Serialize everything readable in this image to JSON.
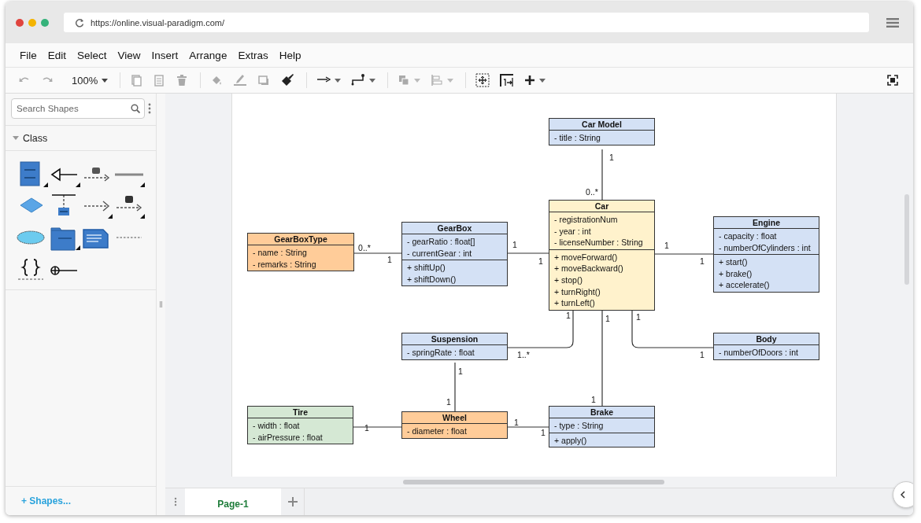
{
  "browser": {
    "url": "https://online.visual-paradigm.com/"
  },
  "menu": [
    "File",
    "Edit",
    "Select",
    "View",
    "Insert",
    "Arrange",
    "Extras",
    "Help"
  ],
  "toolbar": [
    [
      {
        "kind": "undo",
        "disabled": true
      },
      {
        "kind": "redo",
        "disabled": true
      },
      {
        "kind": "zoom",
        "label": "100%",
        "disabled": false
      }
    ],
    [
      {
        "kind": "copy",
        "disabled": true
      },
      {
        "kind": "paste",
        "disabled": true
      },
      {
        "kind": "delete",
        "disabled": true
      }
    ],
    [
      {
        "kind": "fill",
        "disabled": true
      },
      {
        "kind": "line-color",
        "disabled": true
      },
      {
        "kind": "shadow",
        "disabled": true
      },
      {
        "kind": "format",
        "disabled": false
      }
    ],
    [
      {
        "kind": "connector",
        "disabled": false
      },
      {
        "kind": "waypoint",
        "disabled": false
      }
    ],
    [
      {
        "kind": "to-front",
        "disabled": true
      },
      {
        "kind": "align",
        "disabled": true
      }
    ],
    [
      {
        "kind": "fit",
        "disabled": false
      },
      {
        "kind": "page-size",
        "disabled": false
      },
      {
        "kind": "insert",
        "disabled": false
      }
    ]
  ],
  "toolbar_right": [
    {
      "kind": "fullscreen",
      "disabled": false
    }
  ],
  "sidebar": {
    "search": {
      "placeholder": "Search Shapes"
    },
    "section": {
      "title": "Class",
      "expanded": true,
      "shapes": [
        {
          "kind": "class"
        },
        {
          "kind": "generalization"
        },
        {
          "kind": "usage"
        },
        {
          "kind": "association"
        },
        {
          "kind": "diamond"
        },
        {
          "kind": "association-class"
        },
        {
          "kind": "dependency"
        },
        {
          "kind": "abstraction"
        },
        {
          "kind": "collaboration"
        },
        {
          "kind": "package"
        },
        {
          "kind": "note"
        },
        {
          "kind": "anchor"
        },
        {
          "kind": "constraint"
        },
        {
          "kind": "containment"
        }
      ]
    },
    "shapes_link": "+ Shapes..."
  },
  "diagram": {
    "classes": [
      {
        "name": "Car Model",
        "color": "#d4e1f5",
        "attributes": [
          "- title : String"
        ]
      },
      {
        "name": "GearBoxType",
        "color": "#ffcc99",
        "attributes": [
          "- name : String",
          "- remarks : String"
        ]
      },
      {
        "name": "GearBox",
        "color": "#d4e1f5",
        "attributes": [
          "- gearRatio : float[]",
          "- currentGear : int"
        ],
        "operations": [
          "+ shiftUp()",
          "+ shiftDown()"
        ]
      },
      {
        "name": "Car",
        "color": "#fff2cc",
        "attributes": [
          "- registrationNum",
          "- year : int",
          "- licenseNumber : String"
        ],
        "operations": [
          "+ moveForward()",
          "+ moveBackward()",
          "+ stop()",
          "+ turnRight()",
          "+ turnLeft()"
        ]
      },
      {
        "name": "Engine",
        "color": "#d4e1f5",
        "attributes": [
          "- capacity : float",
          "- numberOfCylinders : int"
        ],
        "operations": [
          "+ start()",
          "+ brake()",
          "+ accelerate()"
        ]
      },
      {
        "name": "Suspension",
        "color": "#d4e1f5",
        "attributes": [
          "- springRate : float"
        ]
      },
      {
        "name": "Body",
        "color": "#d4e1f5",
        "attributes": [
          "- numberOfDoors : int"
        ]
      },
      {
        "name": "Tire",
        "color": "#d5e8d4",
        "attributes": [
          "- width : float",
          "- airPressure : float"
        ]
      },
      {
        "name": "Wheel",
        "color": "#ffcc99",
        "attributes": [
          "- diameter : float"
        ]
      },
      {
        "name": "Brake",
        "color": "#d4e1f5",
        "attributes": [
          "- type : String"
        ],
        "operations": [
          "+ apply()"
        ]
      }
    ],
    "associations": [
      {
        "ends": [
          "1",
          "0..*"
        ]
      },
      {
        "ends": [
          "0..*",
          "1"
        ]
      },
      {
        "ends": [
          "1",
          "1"
        ]
      },
      {
        "ends": [
          "1",
          "1"
        ]
      },
      {
        "ends": [
          "1",
          "1..*"
        ]
      },
      {
        "ends": [
          "1",
          "1"
        ]
      },
      {
        "ends": [
          "1",
          "1"
        ]
      },
      {
        "ends": [
          "1",
          "1"
        ]
      },
      {
        "ends": [
          "1"
        ]
      },
      {
        "ends": [
          "1",
          "1"
        ]
      }
    ]
  },
  "pages": [
    {
      "label": "Page-1",
      "selected": true
    }
  ]
}
